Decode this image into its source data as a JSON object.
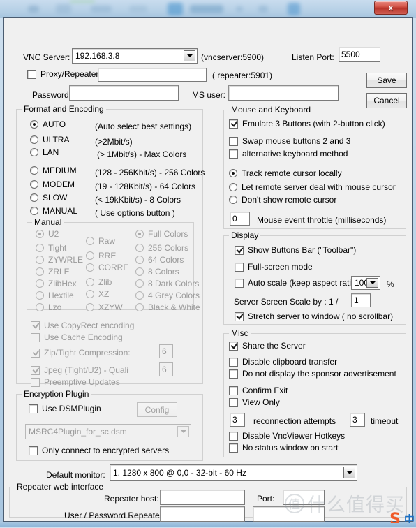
{
  "window": {
    "close_label": "x"
  },
  "connection": {
    "vnc_server_label": "VNC Server:",
    "vnc_server_value": "192.168.3.8",
    "vnc_server_hint": "(vncserver:5900)",
    "listen_port_label": "Listen Port:",
    "listen_port_value": "5500",
    "proxy_repeater_label": "Proxy/Repeater",
    "proxy_repeater_checked": false,
    "proxy_repeater_value": "",
    "repeater_hint": "( repeater:5901)",
    "password_label": "Password:",
    "password_value": "",
    "ms_user_label": "MS user:",
    "ms_user_value": "",
    "save_label": "Save",
    "cancel_label": "Cancel"
  },
  "format_encoding": {
    "title": "Format and Encoding",
    "options": [
      {
        "label": "AUTO",
        "desc": "(Auto select best settings)",
        "selected": true
      },
      {
        "label": "ULTRA",
        "desc": "(>2Mbit/s)",
        "selected": false
      },
      {
        "label": "LAN",
        "desc": "(> 1Mbit/s) - Max Colors",
        "selected": false
      },
      {
        "label": "MEDIUM",
        "desc": "(128 - 256Kbit/s) - 256 Colors",
        "selected": false
      },
      {
        "label": "MODEM",
        "desc": "(19 - 128Kbit/s) - 64 Colors",
        "selected": false
      },
      {
        "label": "SLOW",
        "desc": "(< 19kKbit/s) - 8 Colors",
        "selected": false
      },
      {
        "label": "MANUAL",
        "desc": "( Use options button )",
        "selected": false
      }
    ],
    "manual": {
      "title": "Manual",
      "enabled": false,
      "col1": [
        {
          "label": "U2",
          "selected": true
        },
        {
          "label": "Tight",
          "selected": false
        },
        {
          "label": "ZYWRLE",
          "selected": false
        },
        {
          "label": "ZRLE",
          "selected": false
        },
        {
          "label": "ZlibHex",
          "selected": false
        },
        {
          "label": "Hextile",
          "selected": false
        },
        {
          "label": "Lzo",
          "selected": false
        }
      ],
      "col2": [
        {
          "label": "Raw",
          "selected": false
        },
        {
          "label": "RRE",
          "selected": false
        },
        {
          "label": "CORRE",
          "selected": false
        },
        {
          "label": "Zlib",
          "selected": false
        },
        {
          "label": "XZ",
          "selected": false
        },
        {
          "label": "XZYW",
          "selected": false
        }
      ],
      "col3": [
        {
          "label": "Full Colors",
          "selected": true
        },
        {
          "label": "256 Colors",
          "selected": false
        },
        {
          "label": "64 Colors",
          "selected": false
        },
        {
          "label": "8 Colors",
          "selected": false
        },
        {
          "label": "8 Dark Colors",
          "selected": false
        },
        {
          "label": "4 Grey Colors",
          "selected": false
        },
        {
          "label": "Black & White",
          "selected": false
        }
      ]
    },
    "extras": [
      {
        "label": "Use CopyRect encoding",
        "checked": true,
        "enabled": false
      },
      {
        "label": "Use Cache Encoding",
        "checked": false,
        "enabled": false
      },
      {
        "label": "Zip/Tight Compression:",
        "checked": true,
        "enabled": false,
        "value": "6"
      },
      {
        "label": "Jpeg (Tight/U2) - Quali",
        "checked": true,
        "enabled": false,
        "value": "6"
      },
      {
        "label": "Preemptive Updates",
        "checked": false,
        "enabled": false
      }
    ]
  },
  "mouse_keyboard": {
    "title": "Mouse and Keyboard",
    "checks": [
      {
        "label": "Emulate 3 Buttons (with 2-button click)",
        "checked": true
      },
      {
        "label": "Swap mouse buttons 2 and 3",
        "checked": false
      },
      {
        "label": "alternative keyboard method",
        "checked": false
      }
    ],
    "cursor_options": [
      {
        "label": "Track remote cursor locally",
        "selected": true
      },
      {
        "label": "Let remote server deal with mouse cursor",
        "selected": false
      },
      {
        "label": "Don't show remote cursor",
        "selected": false
      }
    ],
    "throttle_value": "0",
    "throttle_label": "Mouse event throttle (milliseconds)"
  },
  "display": {
    "title": "Display",
    "show_toolbar_label": "Show Buttons Bar (\"Toolbar\")",
    "show_toolbar_checked": true,
    "fullscreen_label": "Full-screen mode",
    "fullscreen_checked": false,
    "autoscale_label": "Auto scale (keep aspect ratio)",
    "autoscale_checked": false,
    "autoscale_value": "100",
    "percent_label": "%",
    "server_scale_label": "Server Screen Scale by :",
    "server_scale_numer": "1 /",
    "server_scale_denom": "1",
    "stretch_label": "Stretch server to window ( no scrollbar)",
    "stretch_checked": true
  },
  "misc": {
    "title": "Misc",
    "checks": [
      {
        "label": "Share the Server",
        "checked": true
      },
      {
        "label": "Disable clipboard transfer",
        "checked": false
      },
      {
        "label": "Do not display the sponsor advertisement",
        "checked": false
      },
      {
        "label": "Confirm Exit",
        "checked": false
      },
      {
        "label": "View Only",
        "checked": false
      }
    ],
    "reconnect_value": "3",
    "reconnect_label": "reconnection attempts",
    "timeout_value": "3",
    "timeout_label": "timeout",
    "hotkeys_label": "Disable VncViewer Hotkeys",
    "hotkeys_checked": false,
    "nostatus_label": "No status window on start",
    "nostatus_checked": false
  },
  "encryption": {
    "title": "Encryption Plugin",
    "use_dsm_label": "Use DSMPlugin",
    "use_dsm_checked": false,
    "config_label": "Config",
    "plugin_value": "MSRC4Plugin_for_sc.dsm",
    "only_encrypted_label": "Only connect to encrypted servers",
    "only_encrypted_checked": false
  },
  "monitor": {
    "label": "Default monitor:",
    "value": "1. 1280 x 800 @ 0,0 - 32-bit - 60 Hz"
  },
  "repeater_web": {
    "title": "Repeater web interface",
    "host_label": "Repeater host:",
    "host_value": "",
    "port_label": "Port:",
    "port_value": "",
    "user_pass_label": "User / Password Repeater:",
    "user_value": "",
    "pass_value": ""
  },
  "watermark": {
    "circle": "值",
    "text": "什么值得买",
    "ime": "S",
    "ime_lang": "中"
  }
}
